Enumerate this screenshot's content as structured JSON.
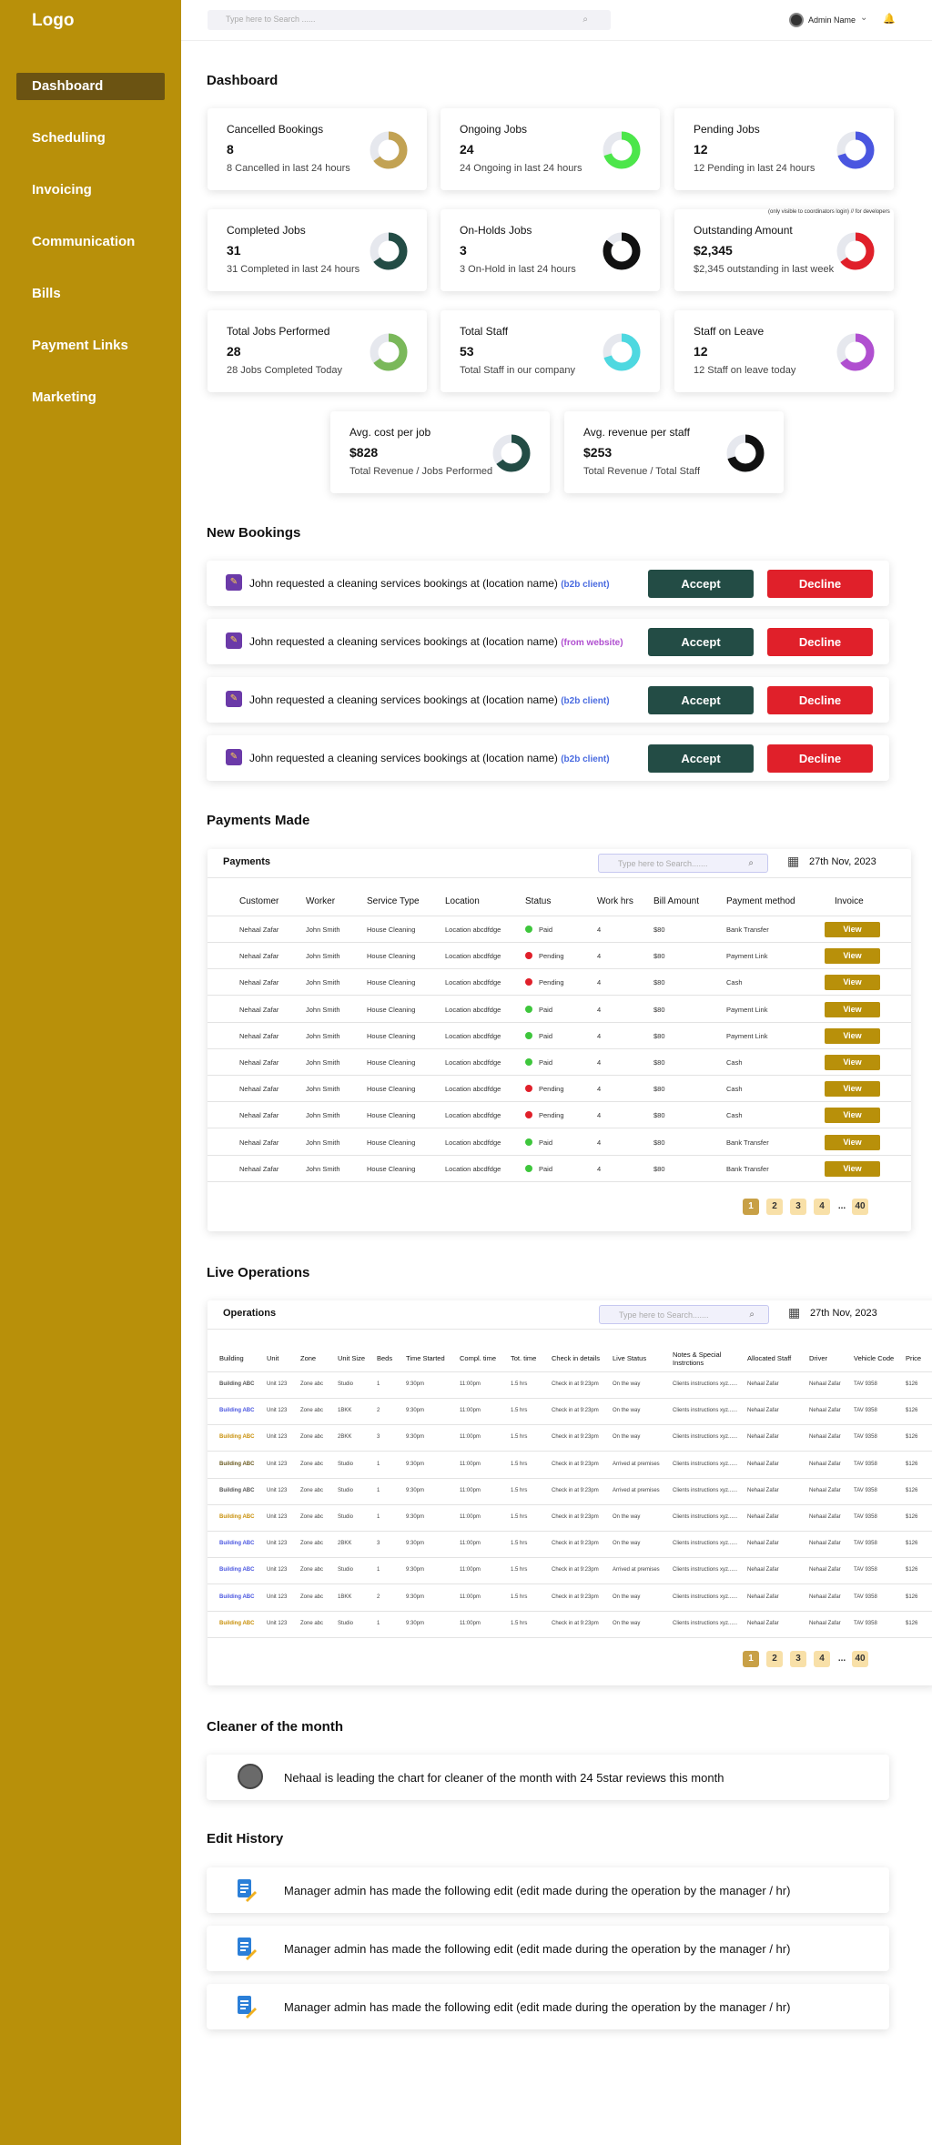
{
  "sidebar": {
    "logo": "Logo",
    "items": [
      "Dashboard",
      "Scheduling",
      "Invoicing",
      "Communication",
      "Bills",
      "Payment Links",
      "Marketing"
    ],
    "active": 0
  },
  "topbar": {
    "search_placeholder": "Type here to Search ......",
    "admin_name": "Admin Name"
  },
  "dashboard": {
    "title": "Dashboard",
    "note": "(only visible to coordinators login) // for developers",
    "cards": [
      {
        "title": "Cancelled Bookings",
        "value": "8",
        "sub": "8 Cancelled in last 24 hours",
        "color": "#c2a253",
        "fill": 0.65,
        "dark": false
      },
      {
        "title": "Ongoing Jobs",
        "value": "24",
        "sub": "24 Ongoing in last 24 hours",
        "color": "#4ce64a",
        "fill": 0.7,
        "dark": false
      },
      {
        "title": "Pending Jobs",
        "value": "12",
        "sub": "12 Pending in last 24 hours",
        "color": "#4a56e0",
        "fill": 0.7,
        "dark": false
      },
      {
        "title": "Completed Jobs",
        "value": "31",
        "sub": "31 Completed in last 24 hours",
        "color": "#234c45",
        "fill": 0.65,
        "dark": false
      },
      {
        "title": "On-Holds Jobs",
        "value": "3",
        "sub": "3 On-Hold in last 24 hours",
        "color": "#111111",
        "fill": 0.85,
        "dark": false
      },
      {
        "title": "Outstanding Amount",
        "value": "$2,345",
        "sub": "$2,345 outstanding in last week",
        "color": "#e0202a",
        "fill": 0.65,
        "dark": false
      },
      {
        "title": "Total Jobs Performed",
        "value": "28",
        "sub": "28 Jobs Completed Today",
        "color": "#7ab85a",
        "fill": 0.65,
        "dark": false
      },
      {
        "title": "Total Staff",
        "value": "53",
        "sub": "Total Staff in our company",
        "color": "#4ed8e0",
        "fill": 0.7,
        "dark": false
      },
      {
        "title": "Staff on Leave",
        "value": "12",
        "sub": "12 Staff on leave today",
        "color": "#b04fd0",
        "fill": 0.65,
        "dark": false
      },
      {
        "title": "Avg. cost per job",
        "value": "$828",
        "sub": "Total Revenue / Jobs Performed",
        "color": "#234c45",
        "fill": 0.65,
        "dark": false
      },
      {
        "title": "Avg. revenue per staff",
        "value": "$253",
        "sub": "Total Revenue / Total Staff",
        "color": "#111111",
        "fill": 0.7,
        "dark": false
      }
    ]
  },
  "new_bookings": {
    "title": "New Bookings",
    "text": "John requested a cleaning services bookings at (location name)",
    "accept": "Accept",
    "decline": "Decline",
    "items": [
      {
        "tag": "(b2b client)",
        "kind": "b2b"
      },
      {
        "tag": "(from website)",
        "kind": "web"
      },
      {
        "tag": "(b2b client)",
        "kind": "b2b"
      },
      {
        "tag": "(b2b client)",
        "kind": "b2b"
      }
    ]
  },
  "payments": {
    "section_title": "Payments Made",
    "panel_title": "Payments",
    "search_placeholder": "Type here to Search.......",
    "date": "27th Nov, 2023",
    "columns": [
      "Customer",
      "Worker",
      "Service Type",
      "Location",
      "Status",
      "Work hrs",
      "Bill Amount",
      "Payment method",
      "Invoice"
    ],
    "rows": [
      [
        "Nehaal Zafar",
        "John Smith",
        "House Cleaning",
        "Location abcdfdge",
        "Paid",
        "4",
        "$80",
        "Bank Transfer",
        "View"
      ],
      [
        "Nehaal Zafar",
        "John Smith",
        "House Cleaning",
        "Location abcdfdge",
        "Pending",
        "4",
        "$80",
        "Payment Link",
        "View"
      ],
      [
        "Nehaal Zafar",
        "John Smith",
        "House Cleaning",
        "Location abcdfdge",
        "Pending",
        "4",
        "$80",
        "Cash",
        "View"
      ],
      [
        "Nehaal Zafar",
        "John Smith",
        "House Cleaning",
        "Location abcdfdge",
        "Paid",
        "4",
        "$80",
        "Payment Link",
        "View"
      ],
      [
        "Nehaal Zafar",
        "John Smith",
        "House Cleaning",
        "Location abcdfdge",
        "Paid",
        "4",
        "$80",
        "Payment Link",
        "View"
      ],
      [
        "Nehaal Zafar",
        "John Smith",
        "House Cleaning",
        "Location abcdfdge",
        "Paid",
        "4",
        "$80",
        "Cash",
        "View"
      ],
      [
        "Nehaal Zafar",
        "John Smith",
        "House Cleaning",
        "Location abcdfdge",
        "Pending",
        "4",
        "$80",
        "Cash",
        "View"
      ],
      [
        "Nehaal Zafar",
        "John Smith",
        "House Cleaning",
        "Location abcdfdge",
        "Pending",
        "4",
        "$80",
        "Cash",
        "View"
      ],
      [
        "Nehaal Zafar",
        "John Smith",
        "House Cleaning",
        "Location abcdfdge",
        "Paid",
        "4",
        "$80",
        "Bank Transfer",
        "View"
      ],
      [
        "Nehaal Zafar",
        "John Smith",
        "House Cleaning",
        "Location abcdfdge",
        "Paid",
        "4",
        "$80",
        "Bank Transfer",
        "View"
      ]
    ],
    "pages": [
      "1",
      "2",
      "3",
      "4",
      "...",
      "40"
    ]
  },
  "operations": {
    "section_title": "Live Operations",
    "panel_title": "Operations",
    "search_placeholder": "Type here to Search.......",
    "date": "27th Nov, 2023",
    "columns": [
      "Building",
      "Unit",
      "Zone",
      "Unit Size",
      "Beds",
      "Time Started",
      "Compl. time",
      "Tot. time",
      "Check in details",
      "Live Status",
      "Notes & Special Instrctions",
      "Allocated Staff",
      "Driver",
      "Vehicle Code",
      "Price"
    ],
    "rows": [
      {
        "b": "Building ABC",
        "c": "#555555",
        "unit": "Unit 123",
        "zone": "Zone abc",
        "size": "Studio",
        "beds": "1",
        "st": "9:30pm",
        "ct": "11:00pm",
        "tt": "1.5 hrs",
        "ci": "Check in at 9:23pm",
        "ls": "On the way"
      },
      {
        "b": "Building ABC",
        "c": "#4a56e0",
        "unit": "Unit 123",
        "zone": "Zone abc",
        "size": "1BKK",
        "beds": "2",
        "st": "9:30pm",
        "ct": "11:00pm",
        "tt": "1.5 hrs",
        "ci": "Check in at 9:23pm",
        "ls": "On the way"
      },
      {
        "b": "Building ABC",
        "c": "#c8900a",
        "unit": "Unit 123",
        "zone": "Zone abc",
        "size": "2BKK",
        "beds": "3",
        "st": "9:30pm",
        "ct": "11:00pm",
        "tt": "1.5 hrs",
        "ci": "Check in at 9:23pm",
        "ls": "On the way"
      },
      {
        "b": "Building ABC",
        "c": "#6a5a20",
        "unit": "Unit 123",
        "zone": "Zone abc",
        "size": "Studio",
        "beds": "1",
        "st": "9:30pm",
        "ct": "11:00pm",
        "tt": "1.5 hrs",
        "ci": "Check in at 9:23pm",
        "ls": "Arrived at premises"
      },
      {
        "b": "Building ABC",
        "c": "#555555",
        "unit": "Unit 123",
        "zone": "Zone abc",
        "size": "Studio",
        "beds": "1",
        "st": "9:30pm",
        "ct": "11:00pm",
        "tt": "1.5 hrs",
        "ci": "Check in at 9:23pm",
        "ls": "Arrived at premises"
      },
      {
        "b": "Building ABC",
        "c": "#c8900a",
        "unit": "Unit 123",
        "zone": "Zone abc",
        "size": "Studio",
        "beds": "1",
        "st": "9:30pm",
        "ct": "11:00pm",
        "tt": "1.5 hrs",
        "ci": "Check in at 9:23pm",
        "ls": "On the way"
      },
      {
        "b": "Building ABC",
        "c": "#4a56e0",
        "unit": "Unit 123",
        "zone": "Zone abc",
        "size": "2BKK",
        "beds": "3",
        "st": "9:30pm",
        "ct": "11:00pm",
        "tt": "1.5 hrs",
        "ci": "Check in at 9:23pm",
        "ls": "On the way"
      },
      {
        "b": "Building ABC",
        "c": "#4a56e0",
        "unit": "Unit 123",
        "zone": "Zone abc",
        "size": "Studio",
        "beds": "1",
        "st": "9:30pm",
        "ct": "11:00pm",
        "tt": "1.5 hrs",
        "ci": "Check in at 9:23pm",
        "ls": "Arrived at premises"
      },
      {
        "b": "Building ABC",
        "c": "#4a56e0",
        "unit": "Unit 123",
        "zone": "Zone abc",
        "size": "1BKK",
        "beds": "2",
        "st": "9:30pm",
        "ct": "11:00pm",
        "tt": "1.5 hrs",
        "ci": "Check in at 9:23pm",
        "ls": "On the way"
      },
      {
        "b": "Building ABC",
        "c": "#c8900a",
        "unit": "Unit 123",
        "zone": "Zone abc",
        "size": "Studio",
        "beds": "1",
        "st": "9:30pm",
        "ct": "11:00pm",
        "tt": "1.5 hrs",
        "ci": "Check in at 9:23pm",
        "ls": "On the way"
      }
    ],
    "shared": {
      "notes": "Clients instructions xyz......",
      "staff": "Nehaal Zafar",
      "driver": "Nehaal Zafar",
      "vehicle": "TAV 9358",
      "price": "$126"
    },
    "pages": [
      "1",
      "2",
      "3",
      "4",
      "...",
      "40"
    ]
  },
  "cleaner": {
    "title": "Cleaner of the month",
    "text": "Nehaal is leading the chart for cleaner of the month with 24 5star reviews this month"
  },
  "history": {
    "title": "Edit History",
    "items": [
      "Manager admin has made the following edit (edit made during the operation by the manager / hr)",
      "Manager admin has made the following edit (edit made during the operation by the manager / hr)",
      "Manager admin has made the following edit (edit made during the operation by the manager / hr)"
    ]
  },
  "status_colors": {
    "Paid": "#3ec63c",
    "Pending": "#e0202a"
  }
}
